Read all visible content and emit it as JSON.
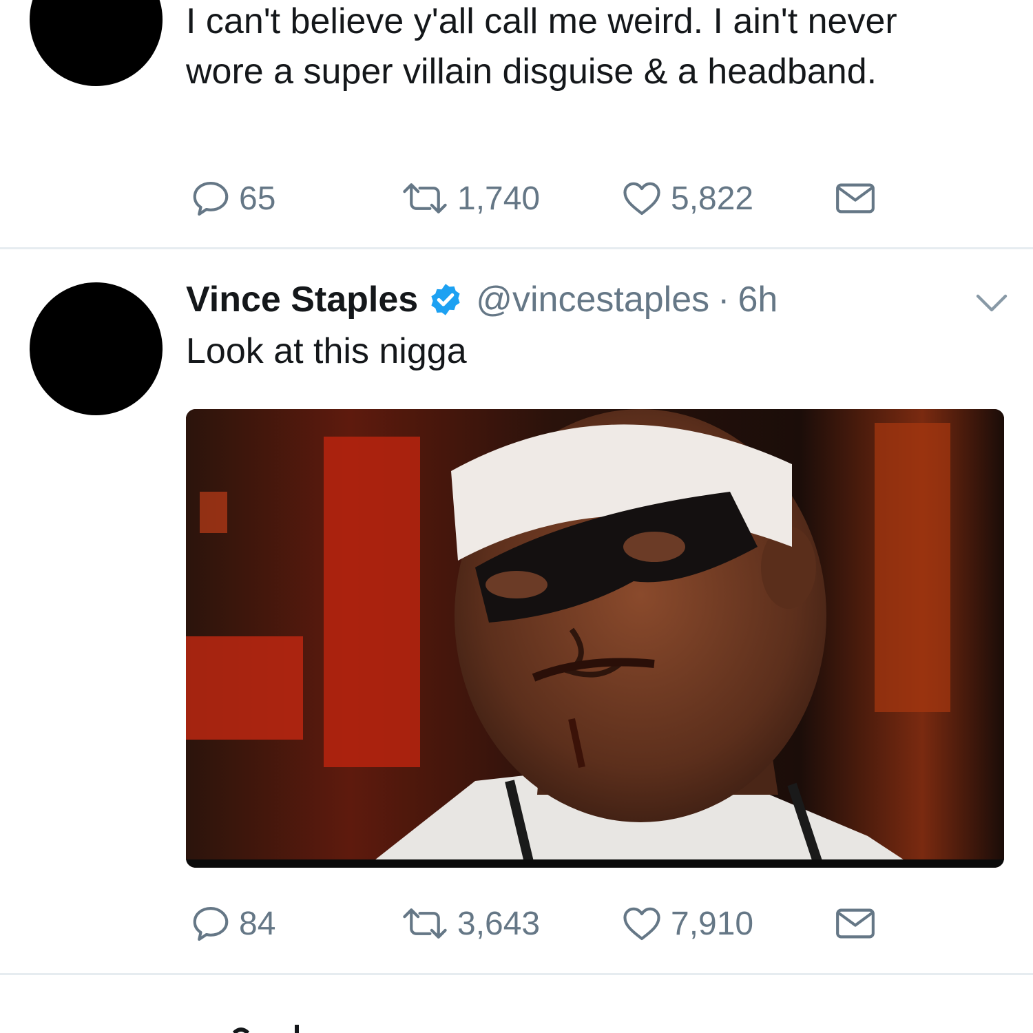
{
  "colors": {
    "text": "#14171a",
    "secondary": "#657786",
    "verified": "#1da1f2",
    "divider": "#e6ecf0",
    "avatar": "#000000"
  },
  "tweets": [
    {
      "text": "I can't believe y'all call me weird. I ain't never wore a super villain disguise & a headband.",
      "replies": "65",
      "retweets": "1,740",
      "likes": "5,822"
    },
    {
      "name": "Vince Staples",
      "verified": true,
      "handle": "@vincestaples",
      "separator": "·",
      "time": "6h",
      "text": "Look at this nigga",
      "media": {
        "type": "gif",
        "icon": "media-image"
      },
      "replies": "84",
      "retweets": "3,643",
      "likes": "7,910"
    }
  ],
  "icons": {
    "reply": "reply-icon",
    "retweet": "retweet-icon",
    "like": "heart-icon",
    "dm": "envelope-icon",
    "more": "chevron-down-icon",
    "verified": "verified-badge-icon"
  }
}
